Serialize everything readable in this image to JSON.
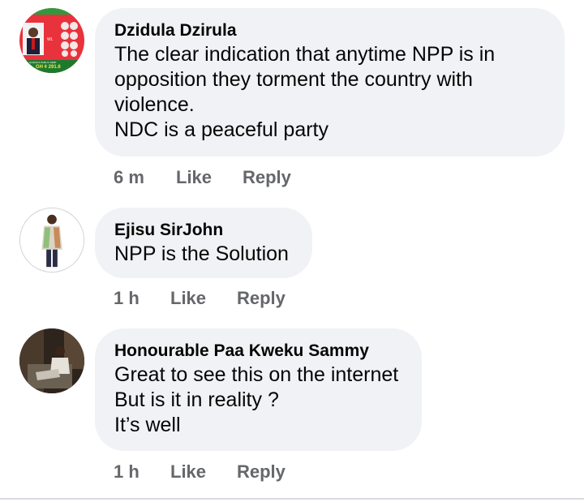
{
  "comments": [
    {
      "author": "Dzidula Dzirula",
      "lines": [
        "The clear indication that anytime NPP is in",
        "opposition they torment the country with",
        "violence.",
        "NDC is a peaceful party"
      ],
      "time": "6 m",
      "like": "Like",
      "reply": "Reply",
      "avatar_text": [
        "WL",
        "GHANA'S PUBLIC DEBT",
        "GH ¢ 291.6"
      ]
    },
    {
      "author": "Ejisu SirJohn",
      "lines": [
        "NPP is the Solution"
      ],
      "time": "1 h",
      "like": "Like",
      "reply": "Reply"
    },
    {
      "author": "Honourable Paa Kweku Sammy",
      "lines": [
        "Great to see this on the internet",
        "But is it in reality ?",
        "It’s well"
      ],
      "time": "1 h",
      "like": "Like",
      "reply": "Reply"
    }
  ],
  "colors": {
    "bubble": "#f0f2f5",
    "action_text": "#65676b",
    "author_text": "#050505"
  }
}
